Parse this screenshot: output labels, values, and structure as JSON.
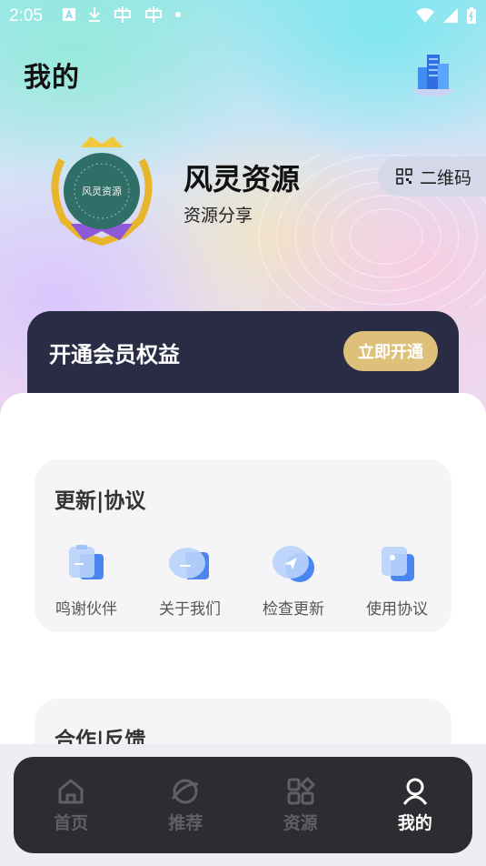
{
  "status_bar": {
    "time": "2:05"
  },
  "header": {
    "title": "我的"
  },
  "profile": {
    "name": "风灵资源",
    "subtitle": "资源分享",
    "avatar_text": "风灵资源",
    "qr_label": "二维码"
  },
  "vip": {
    "title": "开通会员权益",
    "button_label": "立即开通",
    "accent": "#dfc07a"
  },
  "sections": [
    {
      "title": "更新|协议",
      "items": [
        {
          "label": "鸣谢伙伴",
          "icon": "clipboard-icon"
        },
        {
          "label": "关于我们",
          "icon": "chat-bubble-icon"
        },
        {
          "label": "检查更新",
          "icon": "send-icon"
        },
        {
          "label": "使用协议",
          "icon": "document-icon"
        }
      ]
    },
    {
      "title": "合作|反馈"
    }
  ],
  "tabbar": {
    "items": [
      {
        "label": "首页",
        "icon": "home-icon"
      },
      {
        "label": "推荐",
        "icon": "planet-icon"
      },
      {
        "label": "资源",
        "icon": "grid-icon"
      },
      {
        "label": "我的",
        "icon": "user-icon",
        "active": true
      }
    ]
  }
}
